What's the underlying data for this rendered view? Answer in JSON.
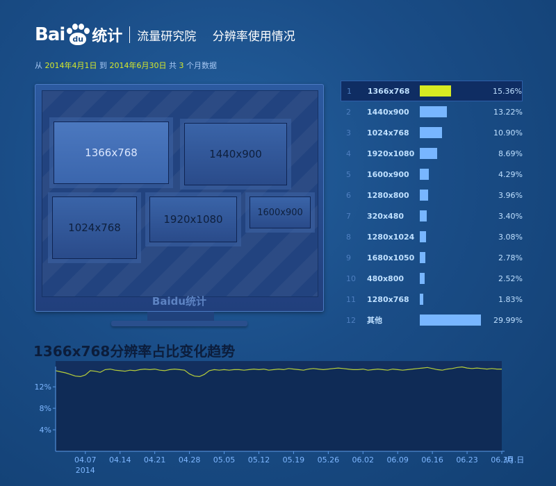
{
  "header": {
    "logo_left": "Bai",
    "logo_paw": "du",
    "logo_right": "统计",
    "section": "流量研究院",
    "page": "分辨率使用情况"
  },
  "daterange": {
    "from_label": "从",
    "start": "2014年4月1日",
    "to_label": "到",
    "end": "2014年6月30日",
    "total_label": "共",
    "months": "3",
    "suffix": "个月数据"
  },
  "monitor": {
    "logo_left": "Bai",
    "logo_paw": "du",
    "logo_right": "统计",
    "boxes": [
      "1366x768",
      "1440x900",
      "1024x768",
      "1920x1080",
      "1600x900"
    ]
  },
  "ranking": [
    {
      "rank": "1",
      "res": "1366x768",
      "pct": "15.36%",
      "value": 15.36
    },
    {
      "rank": "2",
      "res": "1440x900",
      "pct": "13.22%",
      "value": 13.22
    },
    {
      "rank": "3",
      "res": "1024x768",
      "pct": "10.90%",
      "value": 10.9
    },
    {
      "rank": "4",
      "res": "1920x1080",
      "pct": "8.69%",
      "value": 8.69
    },
    {
      "rank": "5",
      "res": "1600x900",
      "pct": "4.29%",
      "value": 4.29
    },
    {
      "rank": "6",
      "res": "1280x800",
      "pct": "3.96%",
      "value": 3.96
    },
    {
      "rank": "7",
      "res": "320x480",
      "pct": "3.40%",
      "value": 3.4
    },
    {
      "rank": "8",
      "res": "1280x1024",
      "pct": "3.08%",
      "value": 3.08
    },
    {
      "rank": "9",
      "res": "1680x1050",
      "pct": "2.78%",
      "value": 2.78
    },
    {
      "rank": "10",
      "res": "480x800",
      "pct": "2.52%",
      "value": 2.52
    },
    {
      "rank": "11",
      "res": "1280x768",
      "pct": "1.83%",
      "value": 1.83
    },
    {
      "rank": "12",
      "res": "其他",
      "pct": "29.99%",
      "value": 29.99
    }
  ],
  "colors": {
    "active_bar": "#d7ea22",
    "bar": "#78b6ff",
    "line": "#b8cf3a"
  },
  "trend": {
    "title": "1366x768分辨率占比变化趋势",
    "year_label": "2014",
    "x_unit": "/月.日"
  },
  "chart_data": {
    "type": "area",
    "title": "1366x768分辨率占比变化趋势",
    "xlabel": "/月.日",
    "ylabel": "",
    "x_start": "04.01",
    "x_end": "06.30",
    "ylim": [
      0,
      16.8
    ],
    "yticks": [
      4,
      8,
      12
    ],
    "ytick_labels": [
      "4%",
      "8%",
      "12%"
    ],
    "xticks": [
      "04.07",
      "04.14",
      "04.21",
      "04.28",
      "05.05",
      "05.12",
      "05.19",
      "05.26",
      "06.02",
      "06.09",
      "06.16",
      "06.23",
      "06.30"
    ],
    "grid": false,
    "series": [
      {
        "values": [
          15.0,
          14.8,
          14.6,
          14.3,
          14.0,
          13.9,
          14.2,
          15.0,
          14.9,
          14.7,
          15.2,
          15.3,
          15.1,
          15.0,
          14.9,
          15.1,
          15.0,
          15.2,
          15.3,
          15.2,
          15.3,
          15.1,
          15.0,
          15.2,
          15.3,
          15.2,
          15.1,
          14.4,
          14.0,
          13.9,
          14.3,
          15.0,
          15.2,
          15.1,
          15.2,
          15.1,
          15.2,
          15.2,
          15.1,
          15.2,
          15.3,
          15.2,
          15.3,
          15.1,
          15.2,
          15.3,
          15.2,
          15.4,
          15.3,
          15.2,
          15.1,
          15.3,
          15.4,
          15.3,
          15.2,
          15.3,
          15.4,
          15.5,
          15.4,
          15.3,
          15.2,
          15.2,
          15.3,
          15.1,
          15.2,
          15.3,
          15.2,
          15.1,
          15.3,
          15.2,
          15.1,
          15.2,
          15.3,
          15.4,
          15.5,
          15.6,
          15.4,
          15.2,
          15.1,
          15.3,
          15.4,
          15.6,
          15.7,
          15.5,
          15.4,
          15.5,
          15.4,
          15.3,
          15.4,
          15.3,
          15.3
        ]
      }
    ]
  }
}
